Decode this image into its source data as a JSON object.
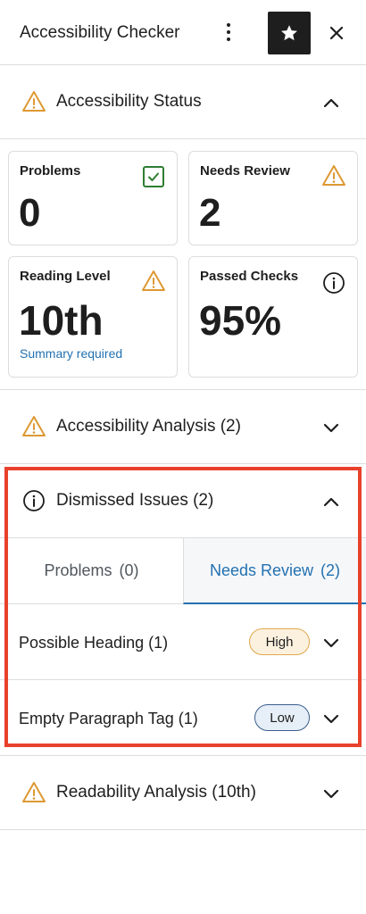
{
  "header": {
    "title": "Accessibility Checker",
    "icons": {
      "more": "more-vertical-icon",
      "star": "star-icon",
      "close": "close-icon"
    }
  },
  "status_section": {
    "label": "Accessibility Status",
    "expanded": true
  },
  "cards": {
    "problems": {
      "label": "Problems",
      "value": "0",
      "icon": "check-box-icon"
    },
    "needs_review": {
      "label": "Needs Review",
      "value": "2",
      "icon": "warning-icon"
    },
    "reading_level": {
      "label": "Reading Level",
      "value": "10th",
      "sublabel": "Summary required",
      "icon": "warning-icon"
    },
    "passed_checks": {
      "label": "Passed Checks",
      "value": "95%",
      "icon": "info-icon"
    }
  },
  "analysis_section": {
    "label": "Accessibility Analysis (2)",
    "expanded": false
  },
  "dismissed_section": {
    "label": "Dismissed Issues (2)",
    "expanded": true,
    "tabs": [
      {
        "label": "Problems",
        "count": "(0)",
        "active": false
      },
      {
        "label": "Needs Review",
        "count": "(2)",
        "active": true
      }
    ],
    "issues": [
      {
        "label": "Possible Heading (1)",
        "badge": "High"
      },
      {
        "label": "Empty Paragraph Tag (1)",
        "badge": "Low"
      }
    ]
  },
  "readability_section": {
    "label": "Readability Analysis (10th)",
    "expanded": false
  },
  "colors": {
    "accent": "#2271b1",
    "warning": "#dd9933",
    "success": "#2e7d32",
    "highlight": "#e8412c"
  }
}
